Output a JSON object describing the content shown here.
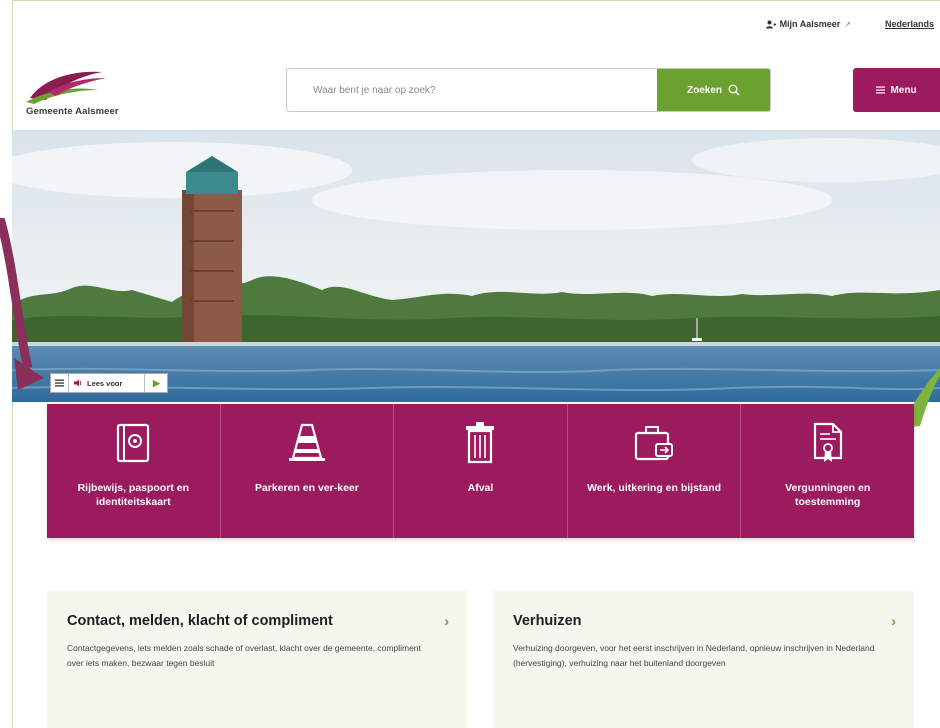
{
  "utility": {
    "account_label": "Mijn Aalsmeer",
    "language_label": "Nederlands"
  },
  "header": {
    "logo_text": "Gemeente Aalsmeer",
    "search_placeholder": "Waar bent je naar op zoek?",
    "search_button_label": "Zoeken",
    "menu_button_label": "Menu"
  },
  "readspeaker": {
    "listen_label": "Lees voor"
  },
  "tiles": [
    {
      "label": "Rijbewijs, paspoort en identiteitskaart",
      "icon": "passport-icon"
    },
    {
      "label": "Parkeren en ver-keer",
      "icon": "traffic-cone-icon"
    },
    {
      "label": "Afval",
      "icon": "trash-bin-icon"
    },
    {
      "label": "Werk, uitkering en bijstand",
      "icon": "briefcase-icon"
    },
    {
      "label": "Vergunningen en toestemming",
      "icon": "permit-document-icon"
    }
  ],
  "cards": [
    {
      "title": "Contact, melden, klacht of compliment",
      "text": "Contactgegevens, iets melden zoals schade of overlast, klacht over de gemeente, compliment over iets maken, bezwaar tegen besluit"
    },
    {
      "title": "Verhuizen",
      "text": "Verhuizing doorgeven, voor het eerst inschrijven in Nederland, opnieuw inschrijven in Nederland (hervestiging), verhuizing naar het buitenland doorgeven"
    }
  ],
  "colors": {
    "brand_magenta": "#9b1b5e",
    "brand_green": "#6aa12f",
    "card_background": "#f4f7ee"
  }
}
